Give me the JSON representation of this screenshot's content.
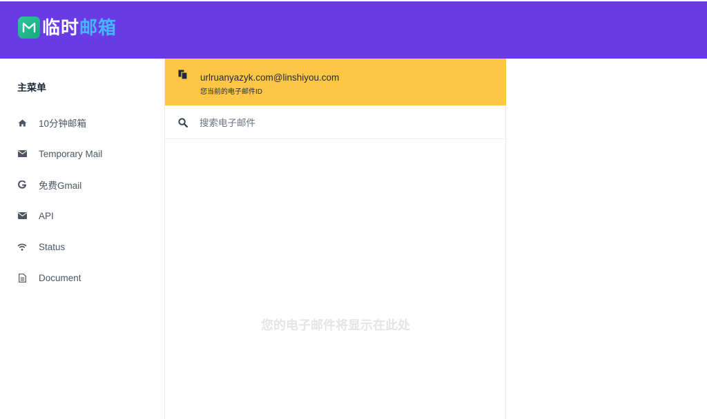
{
  "header": {
    "logo_part1": "临时",
    "logo_part2": "邮箱",
    "logo_mark_letter": "M",
    "color_bg": "#6a3be4"
  },
  "sidebar": {
    "title": "主菜单",
    "items": [
      {
        "label": "10分钟邮箱",
        "icon": "home-icon"
      },
      {
        "label": "Temporary Mail",
        "icon": "envelope-icon"
      },
      {
        "label": "免费Gmail",
        "icon": "google-icon"
      },
      {
        "label": "API",
        "icon": "envelope-icon"
      },
      {
        "label": "Status",
        "icon": "wifi-icon"
      },
      {
        "label": "Document",
        "icon": "document-icon"
      }
    ]
  },
  "mailbox": {
    "email": "urlruanyazyk.com@linshiyou.com",
    "email_caption": "您当前的电子邮件ID",
    "bar_color": "#fdc646"
  },
  "search": {
    "placeholder": "搜索电子邮件"
  },
  "inbox": {
    "empty_message": "您的电子邮件将显示在此处"
  }
}
